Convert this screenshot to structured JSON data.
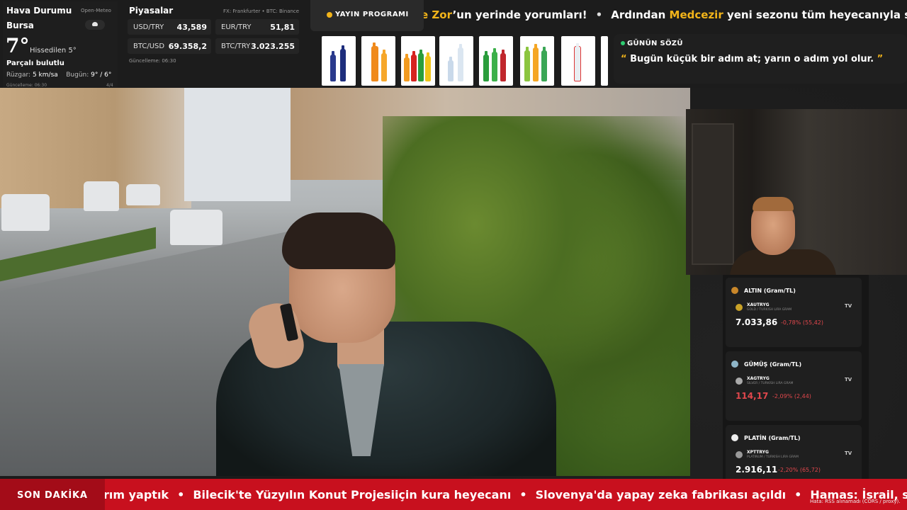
{
  "weather": {
    "title": "Hava Durumu",
    "source": "Open-Meteo",
    "city": "Bursa",
    "temp": "7°",
    "feels_like": "Hissedilen 5°",
    "condition": "Parçalı bulutlu",
    "wind_label": "Rüzgar:",
    "wind_value": "5 km/sa",
    "today_label": "Bugün:",
    "today_value": "9° / 6°",
    "updated": "Güncelleme: 06:30",
    "page": "4/4",
    "icon": "partly-cloudy-icon"
  },
  "markets": {
    "title": "Piyasalar",
    "source": "FX: Frankfurter • BTC: Binance",
    "items": [
      {
        "label": "USD/TRY",
        "value": "43,589"
      },
      {
        "label": "EUR/TRY",
        "value": "51,81"
      },
      {
        "label": "BTC/USD",
        "value": "69.358,2"
      },
      {
        "label": "BTC/TRY",
        "value": "3.023.255"
      }
    ],
    "updated": "Güncelleme: 06:30"
  },
  "schedule": {
    "label": "YAYIN PROGRAMI"
  },
  "top_ticker": {
    "part1_hl": "e Zor",
    "part1_rest": "’un yerinde yorumları!",
    "sep": "•",
    "part2_pre": "Ardından ",
    "part2_hl": "Medcezir",
    "part2_rest": " yeni sezonu tüm heyecanıyla sizlerle"
  },
  "quote": {
    "label": "GÜNÜN SÖZÜ",
    "open": "“",
    "text": " Bugün küçük bir adım at; yarın o adım yol olur. ",
    "close": "”"
  },
  "metals": [
    {
      "title": "ALTIN (Gram/TL)",
      "symbol": "XAUTRYG",
      "sub": "GOLD / TURKISH LIRA GRAM",
      "price": "7.033,86",
      "change": "-0,78% (55,42)",
      "icon": "medal-gold-icon",
      "price_color": "#ffffff"
    },
    {
      "title": "GÜMÜŞ (Gram/TL)",
      "symbol": "XAGTRYG",
      "sub": "SILVER / TURKISH LIRA GRAM",
      "price": "114,17",
      "change": "-2,09% (2,44)",
      "icon": "medal-silver-icon",
      "price_color": "#e0474c"
    },
    {
      "title": "PLATİN (Gram/TL)",
      "symbol": "XPTTRYG",
      "sub": "PLATINUM / TURKISH LIRA GRAM",
      "price": "2.916,11",
      "change": "-2,20% (65,72)",
      "icon": "circle-white-icon",
      "price_color": "#ffffff"
    }
  ],
  "metals_tv_label": "TV",
  "breaking": {
    "tag": "SON DAKİKA",
    "items": [
      "rım yaptık",
      "Bilecik'te Yüzyılın Konut Projesiiçin kura heyecanı",
      "Slovenya'da yapay zeka fabrikası açıldı",
      "Hamas: İsrail, sahte"
    ],
    "sep": "•",
    "error": "Hata: RSS alınamadı (CORS / proxy)."
  },
  "colors": {
    "accent": "#f2b41a",
    "breaking_red": "#c8101e",
    "negative": "#e0474c",
    "quote_dot": "#2ecc71"
  }
}
